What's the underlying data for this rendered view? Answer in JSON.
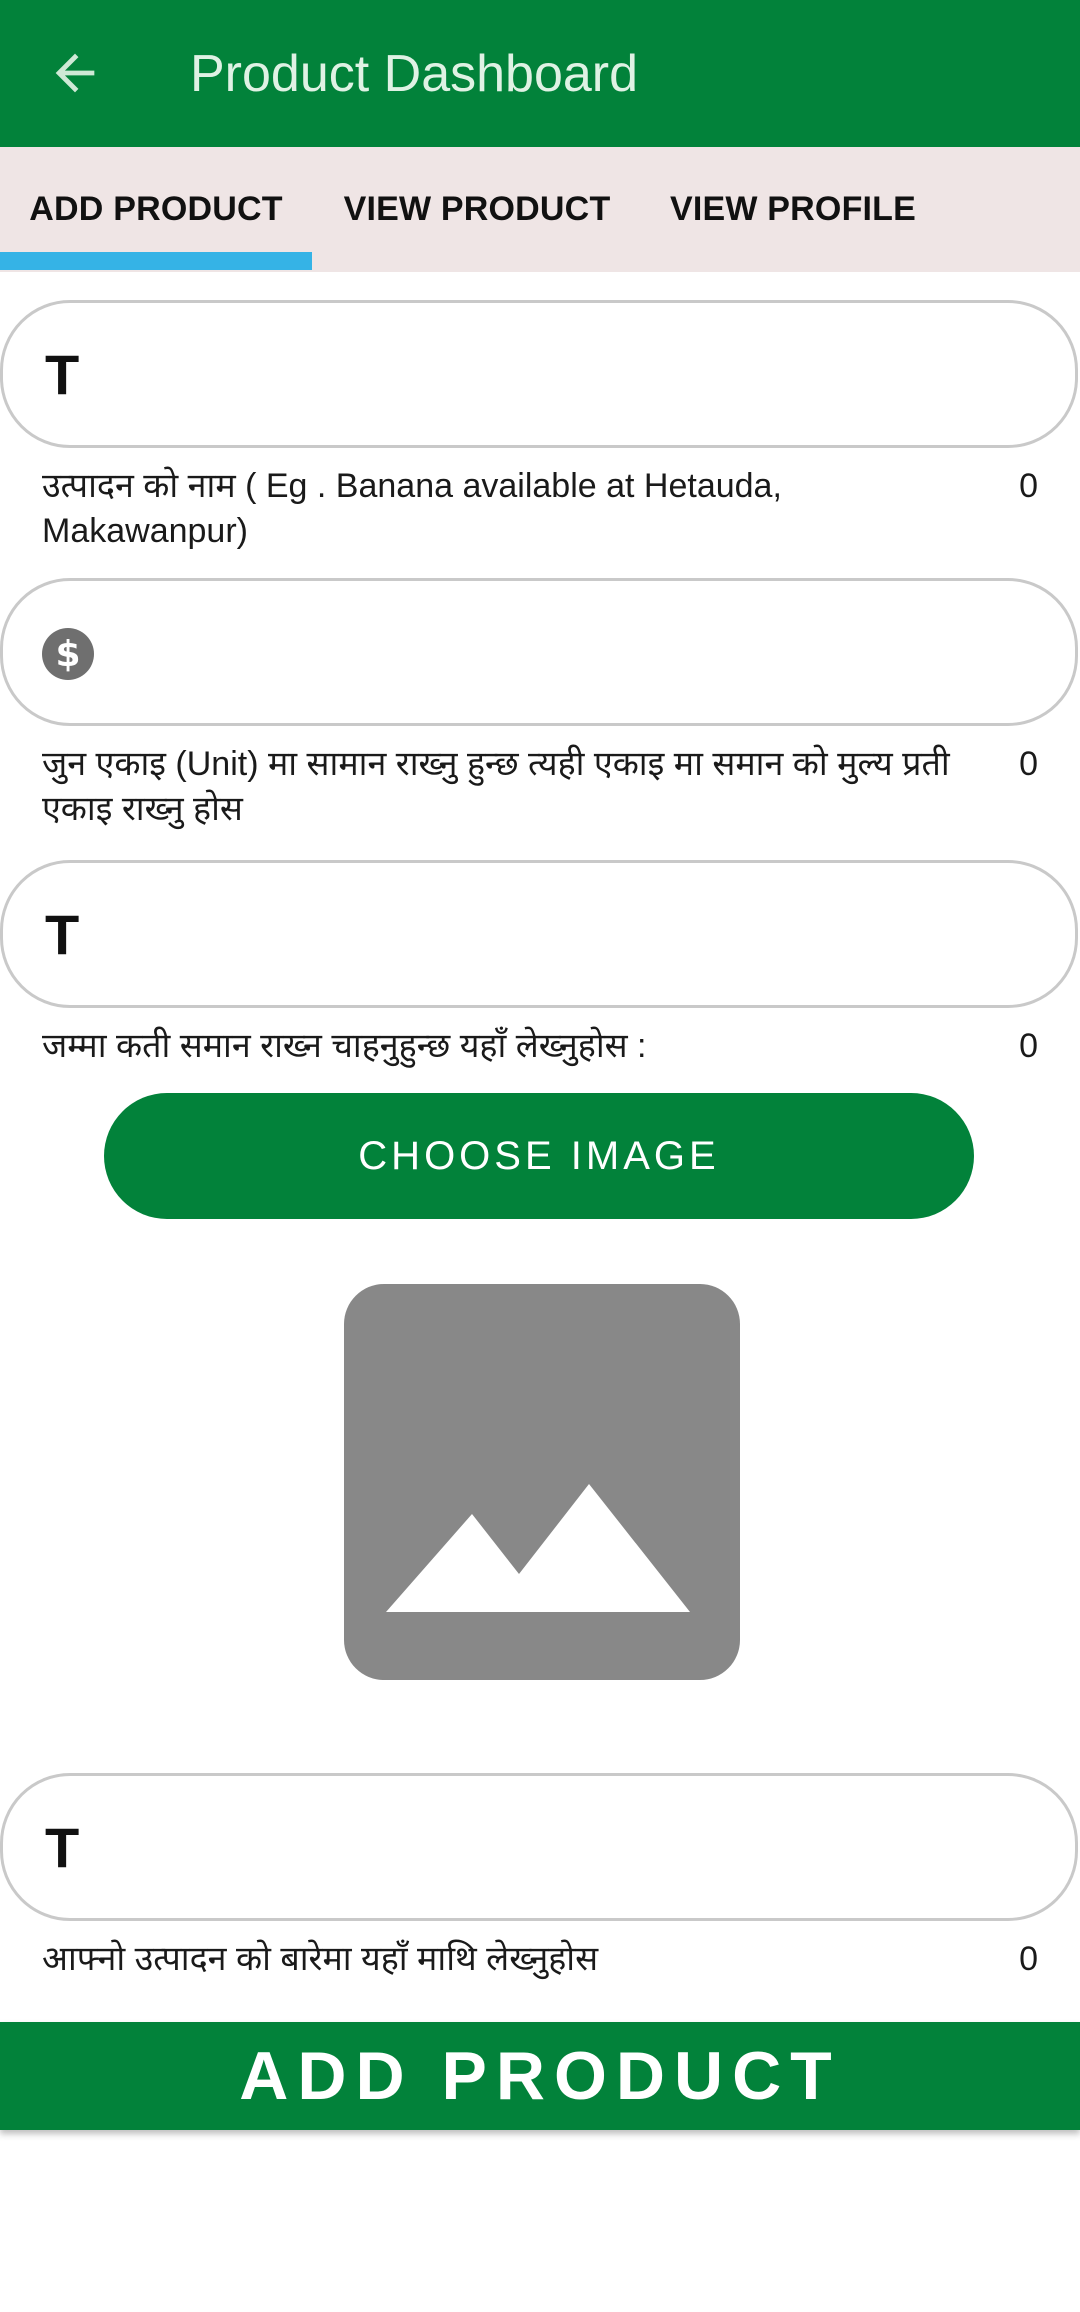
{
  "app_bar": {
    "title": "Product Dashboard",
    "back_icon": "arrow-left-icon"
  },
  "tabs": [
    {
      "label": "ADD PRODUCT",
      "selected": true
    },
    {
      "label": "VIEW PRODUCT",
      "selected": false
    },
    {
      "label": "VIEW PROFILE",
      "selected": false
    }
  ],
  "colors": {
    "primary": "#02823a",
    "tab_bar": "#efe5e5",
    "tab_indicator": "#35b3e6",
    "field_border": "#c9c9c9"
  },
  "form": {
    "product_name": {
      "icon": "T",
      "value": "",
      "helper": "उत्पादन को नाम ( Eg . Banana available at Hetauda, Makawanpur)",
      "counter": "0"
    },
    "price": {
      "icon": "dollar-circle-icon",
      "value": "",
      "helper": "जुन एकाइ (Unit) मा सामान राख्नु हुन्छ त्यही एकाइ मा समान को मुल्य प्रती एकाइ राख्नु होस",
      "counter": "0"
    },
    "quantity": {
      "icon": "T",
      "value": "",
      "helper": "जम्मा कती समान राख्न चाहनुहुन्छ यहाँ लेख्नुहोस :",
      "counter": "0"
    },
    "choose_image_label": "CHOOSE IMAGE",
    "image_placeholder_icon": "image-placeholder-icon",
    "description": {
      "icon": "T",
      "value": "",
      "helper": "आफ्नो उत्पादन को बारेमा यहाँ माथि लेख्नुहोस",
      "counter": "0"
    },
    "submit_label": "ADD PRODUCT"
  }
}
